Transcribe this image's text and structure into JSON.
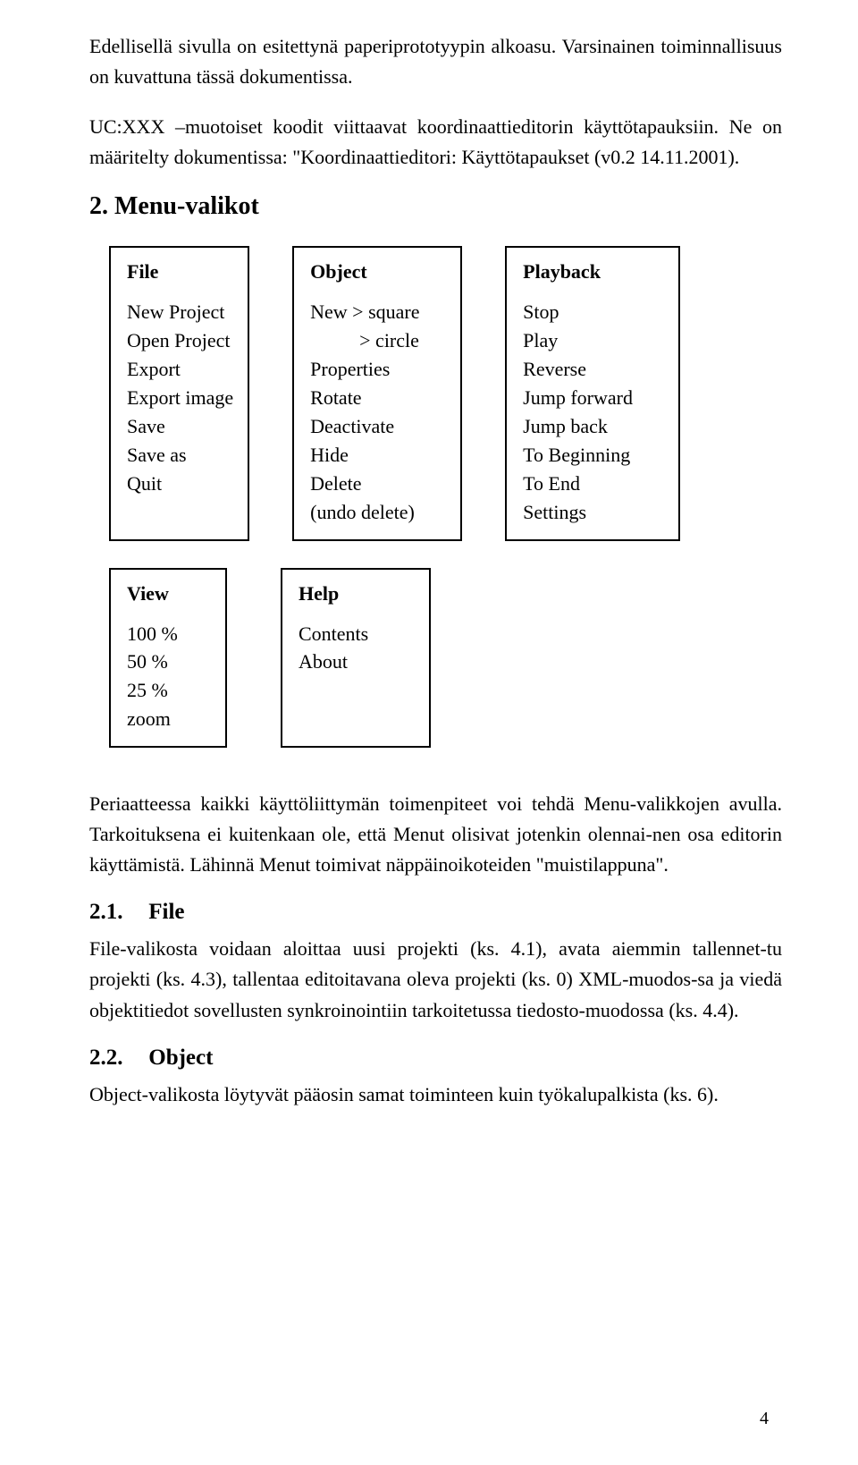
{
  "intro": {
    "p1": "Edellisellä sivulla on esitettynä paperiprototyypin alkoasu. Varsinainen toiminnallisuus on kuvattuna tässä dokumentissa.",
    "p2": "UC:XXX –muotoiset koodit viittaavat koordinaattieditorin käyttötapauksiin. Ne on määritelty dokumentissa: \"Koordinaattieditori: Käyttötapaukset (v0.2 14.11.2001).",
    "heading2": "2. Menu-valikot"
  },
  "menus": {
    "file": {
      "title": "File",
      "items": "New Project\nOpen Project\nExport\nExport image\nSave\nSave as\nQuit"
    },
    "object": {
      "title": "Object",
      "items": "New > square\n          > circle\nProperties\nRotate\nDeactivate\nHide\nDelete\n(undo delete)"
    },
    "playback": {
      "title": "Playback",
      "items": "Stop\nPlay\nReverse\nJump forward\nJump back\nTo Beginning\nTo End\nSettings"
    },
    "view": {
      "title": "View",
      "items": "100 %\n50 %\n25 %\nzoom"
    },
    "help": {
      "title": "Help",
      "items": "Contents\nAbout"
    }
  },
  "post": {
    "p3": "Periaatteessa kaikki käyttöliittymän toimenpiteet voi tehdä Menu-valikkojen avulla. Tarkoituksena ei kuitenkaan ole, että Menut olisivat jotenkin olennai-nen osa editorin käyttämistä. Lähinnä Menut toimivat näppäinoikoteiden \"muistilappuna\".",
    "h21num": "2.1.",
    "h21": "File",
    "p4": "File-valikosta voidaan aloittaa uusi projekti (ks. 4.1), avata aiemmin tallennet-tu projekti (ks. 4.3), tallentaa editoitavana oleva projekti (ks. 0) XML-muodos-sa ja viedä objektitiedot sovellusten synkroinointiin tarkoitetussa tiedosto-muodossa (ks. 4.4).",
    "h22num": "2.2.",
    "h22": "Object",
    "p5": "Object-valikosta löytyvät pääosin samat toiminteen kuin työkalupalkista (ks. 6)."
  },
  "pageNumber": "4"
}
